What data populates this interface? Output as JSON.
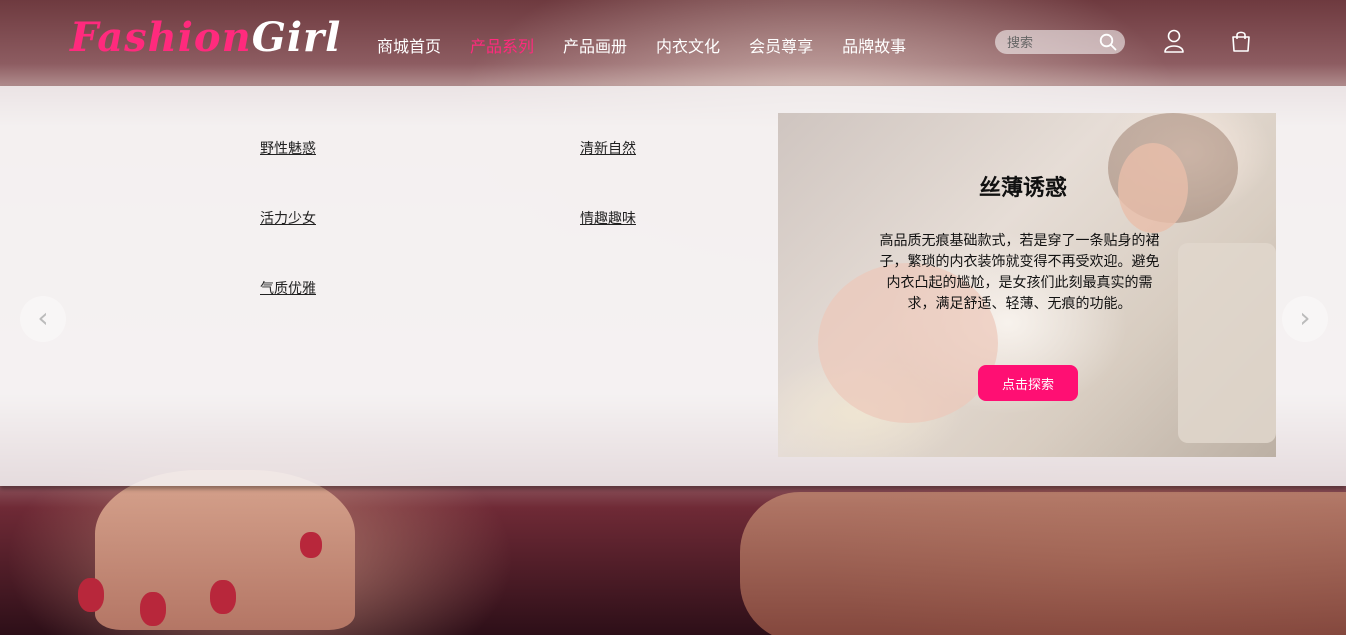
{
  "logo": {
    "fashion": "Fashion",
    "girl": "Girl"
  },
  "nav": {
    "items": [
      "商城首页",
      "产品系列",
      "产品画册",
      "内衣文化",
      "会员尊享",
      "品牌故事"
    ],
    "active_index": 1
  },
  "search": {
    "placeholder": "搜索"
  },
  "icons": {
    "search": "search-icon",
    "user": "user-icon",
    "cart": "shopping-bag-icon",
    "prev": "chevron-left-icon",
    "next": "chevron-right-icon"
  },
  "dropdown": {
    "categories": [
      "野性魅惑",
      "清新自然",
      "活力少女",
      "情趣趣味",
      "气质优雅"
    ],
    "feature": {
      "title": "丝薄诱惑",
      "description": "高品质无痕基础款式，若是穿了一条贴身的裙子，繁琐的内衣装饰就变得不再受欢迎。避免内衣凸起的尴尬，是女孩们此刻最真实的需求，满足舒适、轻薄、无痕的功能。",
      "button": "点击探索"
    }
  },
  "colors": {
    "accent": "#ff2a7d",
    "button": "#ff0f73"
  }
}
